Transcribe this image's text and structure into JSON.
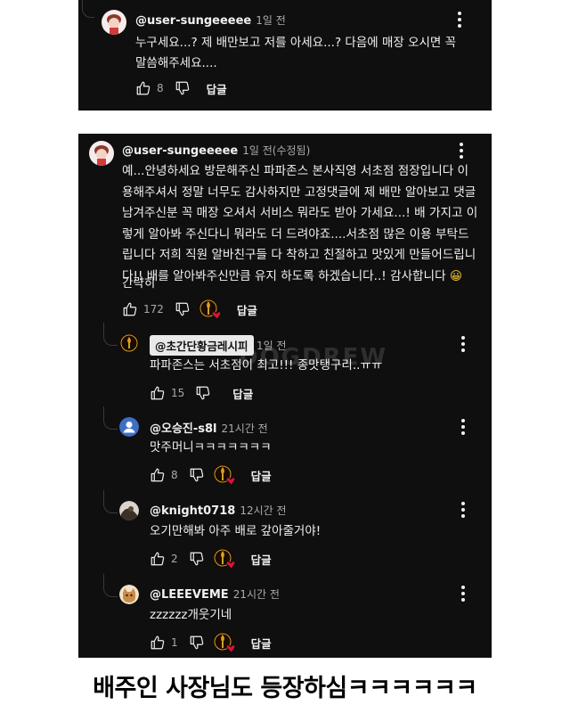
{
  "top_comment": {
    "username": "@user-sungeeeee",
    "time": "1일 전",
    "text_lines": [
      "누구세요...? 제 배만보고 저를 아세요...? 다음에 매장 오시면 꼭",
      "말씀해주세요...."
    ],
    "likes": "8",
    "reply_label": "답글"
  },
  "main_comment": {
    "username": "@user-sungeeeee",
    "time": "1일 전(수정됨)",
    "text_lines": [
      "예...안녕하세요 방문해주신 파파존스 본사직영 서초점 점장입니다 이",
      "용해주셔서 정말 너무도 감사하지만 고정댓글에 제 배만 알아보고 댓글",
      "남겨주신분 꼭 매장 오셔서 서비스 뭐라도 받아 가세요...! 배 가지고 이",
      "렇게 알아봐 주신다니 뭐라도 더 드려야죠....서초점 많은 이용 부탁드",
      "립니다 저희 직원 알바친구들 다 착하고 친절하고 맛있게 만들어드립니",
      "다!! 배를 알아봐주신만큼 유지 하도록 하겠습니다..! 감사합니다"
    ],
    "emoji": "😀",
    "collapse_label": "간략히",
    "likes": "172",
    "reply_label": "답글"
  },
  "replies": [
    {
      "username": "@초간단황금레시피",
      "time": "1일 전",
      "text": "파파존스는 서초점이 최고!!! 종맛탱구리..ㅠㅠ",
      "likes": "15",
      "reply_label": "답글",
      "highlighted": true,
      "heart": false
    },
    {
      "username": "@오승진-s8l",
      "time": "21시간 전",
      "text": "맛주머니ㅋㅋㅋㅋㅋㅋㅋ",
      "likes": "8",
      "reply_label": "답글",
      "highlighted": false,
      "heart": true
    },
    {
      "username": "@knight0718",
      "time": "12시간 전",
      "text": "오기만해봐 아주 배로 갚아줄거야!",
      "likes": "2",
      "reply_label": "답글",
      "highlighted": false,
      "heart": true
    },
    {
      "username": "@LEEEVEME",
      "time": "21시간 전",
      "text": "zzzzzz개웃기네",
      "likes": "1",
      "reply_label": "답글",
      "highlighted": false,
      "heart": true
    }
  ],
  "watermark": "DOGDREW",
  "caption": "배주인 사장님도 등장하심ㅋㅋㅋㅋㅋㅋ",
  "colors": {
    "background": "#0f0f0f",
    "text": "#f1f1f1",
    "meta": "#aaaaaa",
    "heart": "#e0103a"
  },
  "icons": [
    "thumb-up-icon",
    "thumb-down-icon",
    "creator-heart-icon",
    "more-vert-icon"
  ]
}
